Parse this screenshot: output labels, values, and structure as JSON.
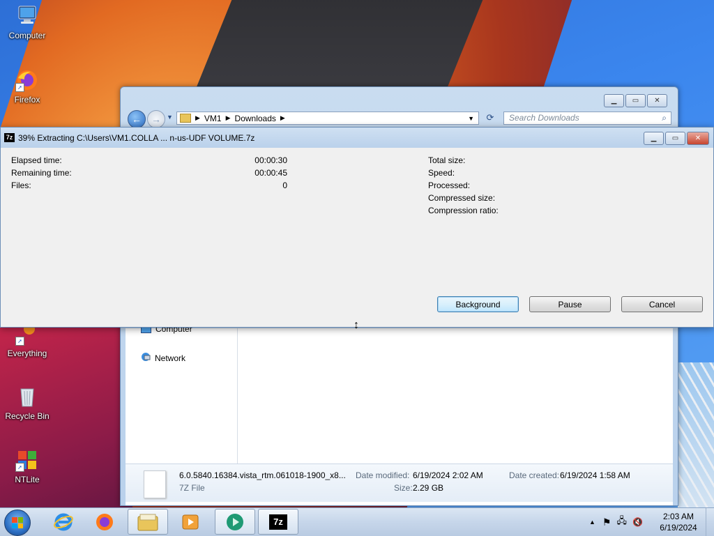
{
  "desktop": {
    "icons": [
      {
        "label": "Computer"
      },
      {
        "label": "Firefox"
      },
      {
        "label": "Everything"
      },
      {
        "label": "Recycle Bin"
      },
      {
        "label": "NTLite"
      }
    ]
  },
  "explorer": {
    "breadcrumb": [
      "VM1",
      "Downloads"
    ],
    "search_placeholder": "Search Downloads",
    "nav_items": [
      {
        "label": "Computer"
      },
      {
        "label": "Network"
      }
    ],
    "details": {
      "file_name": "6.0.5840.16384.vista_rtm.061018-1900_x8...",
      "file_type": "7Z File",
      "date_modified_label": "Date modified:",
      "date_modified_value": "6/19/2024 2:02 AM",
      "date_created_label": "Date created:",
      "date_created_value": "6/19/2024 1:58 AM",
      "size_label": "Size:",
      "size_value": "2.29 GB"
    }
  },
  "zip_progress": {
    "title": "39% Extracting C:\\Users\\VM1.COLLA ... n-us-UDF VOLUME.7z",
    "progress_percent": 39,
    "left_fields": [
      {
        "label": "Elapsed time:",
        "value": "00:00:30"
      },
      {
        "label": "Remaining time:",
        "value": "00:00:45"
      },
      {
        "label": "Files:",
        "value": "0"
      }
    ],
    "right_fields": [
      {
        "label": "Total size:",
        "value": ""
      },
      {
        "label": "Speed:",
        "value": ""
      },
      {
        "label": "Processed:",
        "value": ""
      },
      {
        "label": "Compressed size:",
        "value": ""
      },
      {
        "label": "Compression ratio:",
        "value": ""
      }
    ],
    "buttons": {
      "background": "Background",
      "pause": "Pause",
      "cancel": "Cancel"
    }
  },
  "taskbar": {
    "apps": [
      "internet-explorer-icon",
      "firefox-icon",
      "explorer-icon",
      "media-player-icon",
      "green-app-icon",
      "7zip-icon"
    ],
    "clock_time": "2:03 AM",
    "clock_date": "6/19/2024"
  }
}
